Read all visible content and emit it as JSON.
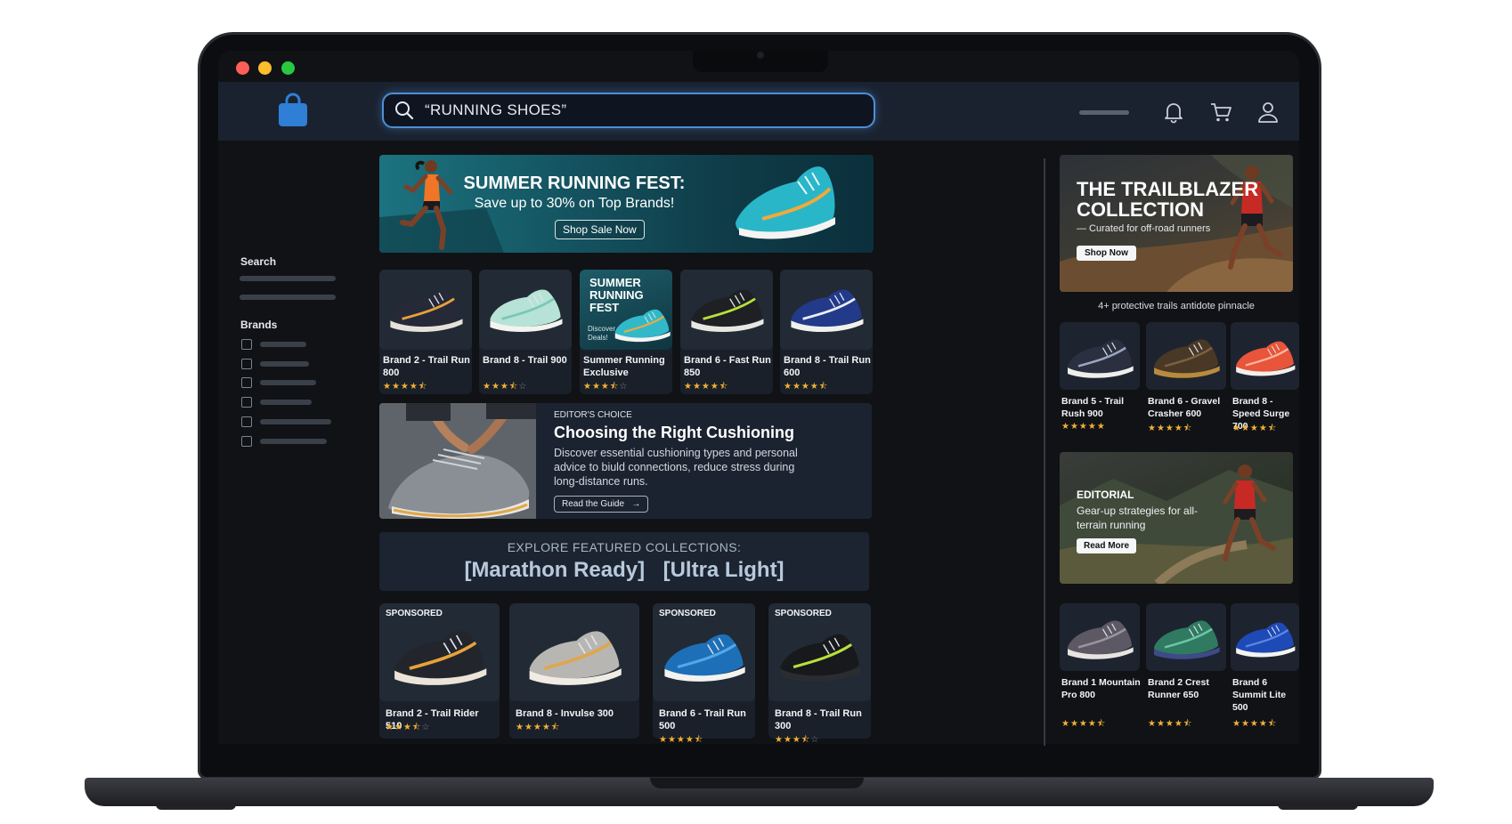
{
  "search": {
    "query": "“RUNNING SHOES”"
  },
  "header_icons": [
    "bell-icon",
    "cart-icon",
    "user-icon"
  ],
  "sidebar": {
    "search_label": "Search",
    "brands_label": "Brands"
  },
  "hero": {
    "title": "SUMMER RUNNING FEST:",
    "subtitle": "Save up to 30% on Top Brands!",
    "button": "Shop Sale Now"
  },
  "row1": [
    {
      "name": "Brand 2 - Trail Run 800",
      "rating": 4.5
    },
    {
      "name": "Brand 8 - Trail 900",
      "rating": 3.5
    },
    {
      "name": "Summer Running Exclusive",
      "rating": 3.5,
      "promo_title": "SUMMER RUNNING FEST",
      "promo_sub": "Discover Deals!"
    },
    {
      "name": "Brand 6 - Fast Run 850",
      "rating": 4.5
    },
    {
      "name": "Brand 8 - Trail Run 600",
      "rating": 4.5
    }
  ],
  "editor": {
    "kicker": "EDITOR'S CHOICE",
    "title": "Choosing the Right Cushioning",
    "body": "Discover essential cushioning types and personal advice to biuld connections, reduce stress during long-distance runs.",
    "button": "Read the Guide"
  },
  "collections": {
    "heading": "EXPLORE FEATURED COLLECTIONS:",
    "links": [
      "[Marathon Ready]",
      "[Ultra Light]"
    ]
  },
  "sponsored": [
    {
      "badge": "SPONSORED",
      "name": "Brand 2 - Trail Rider 510",
      "rating": 3.5
    },
    {
      "badge": "",
      "name": "Brand 8 - Invulse 300",
      "rating": 4.5
    },
    {
      "badge": "SPONSORED",
      "name": "Brand 6 - Trail Run 500",
      "rating": 4.5
    },
    {
      "badge": "SPONSORED",
      "name": "Brand 8 - Trail Run 300",
      "rating": 3.5
    }
  ],
  "trail": {
    "title_line1": "THE TRAILBLAZER",
    "title_line2": "COLLECTION",
    "sub": "— Curated for off-road runners",
    "button": "Shop Now",
    "caption": "4+ protective trails antidote pinnacle"
  },
  "right_row1": [
    {
      "name": "Brand 5 - Trail Rush 900",
      "rating": 5
    },
    {
      "name": "Brand 6 - Gravel Crasher 600",
      "rating": 4.5
    },
    {
      "name": "Brand 8 - Speed Surge 700",
      "rating": 4.5
    }
  ],
  "editorial2": {
    "kicker": "EDITORIAL",
    "body": "Gear-up strategies for all-terrain running",
    "button": "Read More"
  },
  "right_row2": [
    {
      "name": "Brand 1 Mountain Pro 800",
      "rating": 4.5
    },
    {
      "name": "Brand 2 Crest Runner 650",
      "rating": 4.5
    },
    {
      "name": "Brand 6 Summit Lite 500",
      "rating": 4.5
    }
  ],
  "colors": {
    "accent": "#4e8fd6",
    "star": "#f2b134",
    "header_bg": "#1a2230",
    "page_bg": "#101216"
  }
}
